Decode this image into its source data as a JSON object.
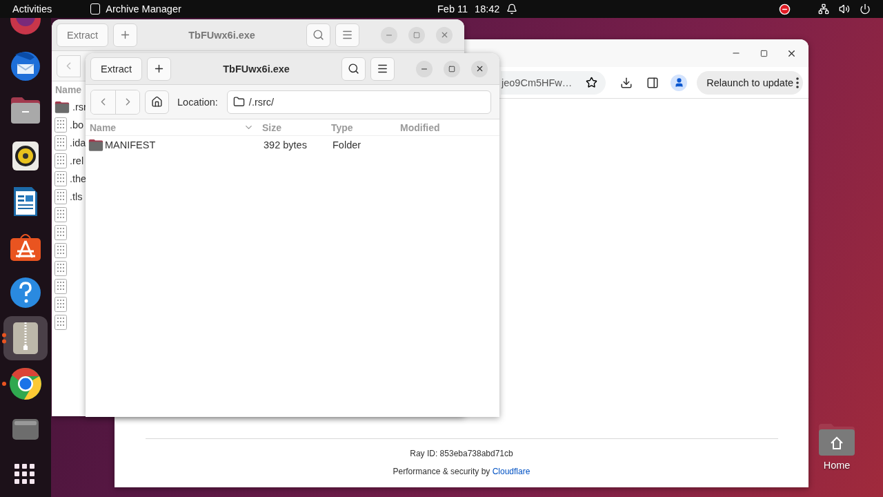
{
  "top_bar": {
    "activities": "Activities",
    "app_name": "Archive Manager",
    "date": "Feb 11",
    "time": "18:42"
  },
  "dock": {
    "items": [
      {
        "kind": "firefox",
        "running": false,
        "selected": false
      },
      {
        "kind": "thunderbird",
        "running": false,
        "selected": false
      },
      {
        "kind": "files",
        "running": false,
        "selected": false
      },
      {
        "kind": "rhythmbox",
        "running": false,
        "selected": false
      },
      {
        "kind": "writer",
        "running": false,
        "selected": false
      },
      {
        "kind": "app_center",
        "running": false,
        "selected": false
      },
      {
        "kind": "help",
        "running": false,
        "selected": false
      },
      {
        "kind": "archive",
        "running": true,
        "selected": true,
        "multiple_windows": true
      },
      {
        "kind": "chrome",
        "running": true,
        "selected": false,
        "multiple_windows": false
      },
      {
        "kind": "drive",
        "running": false,
        "selected": false
      },
      {
        "kind": "app_grid",
        "running": false,
        "selected": false
      }
    ]
  },
  "back_window": {
    "title": "TbFUwx6i.exe",
    "extract": "Extract",
    "column_name": "Name",
    "files": [
      {
        "kind": "folder",
        "name": ".rsr"
      },
      {
        "kind": "binary",
        "name": ".bo"
      },
      {
        "kind": "binary",
        "name": ".ida"
      },
      {
        "kind": "binary",
        "name": ".rel"
      },
      {
        "kind": "binary",
        "name": ".the"
      },
      {
        "kind": "binary",
        "name": ".tls"
      },
      {
        "kind": "binary"
      },
      {
        "kind": "binary"
      },
      {
        "kind": "binary"
      },
      {
        "kind": "binary"
      },
      {
        "kind": "binary"
      },
      {
        "kind": "binary"
      },
      {
        "kind": "binary"
      }
    ]
  },
  "browser": {
    "url": "jeo9Cm5HFw…",
    "relaunch": "Relaunch to update",
    "ray_id": "Ray ID: 853eba738abd71cb",
    "footer": "Performance & security by",
    "footer_link": "Cloudflare"
  },
  "front_window": {
    "title": "TbFUwx6i.exe",
    "extract": "Extract",
    "location_label": "Location:",
    "location": "/.rsrc/",
    "columns": [
      "Name",
      "Size",
      "Type",
      "Modified"
    ],
    "rows": [
      {
        "kind": "folder",
        "name": "MANIFEST",
        "size": "392 bytes",
        "type": "Folder",
        "selected": false
      }
    ]
  },
  "desktop_icons": [
    {
      "label": "Home"
    }
  ]
}
